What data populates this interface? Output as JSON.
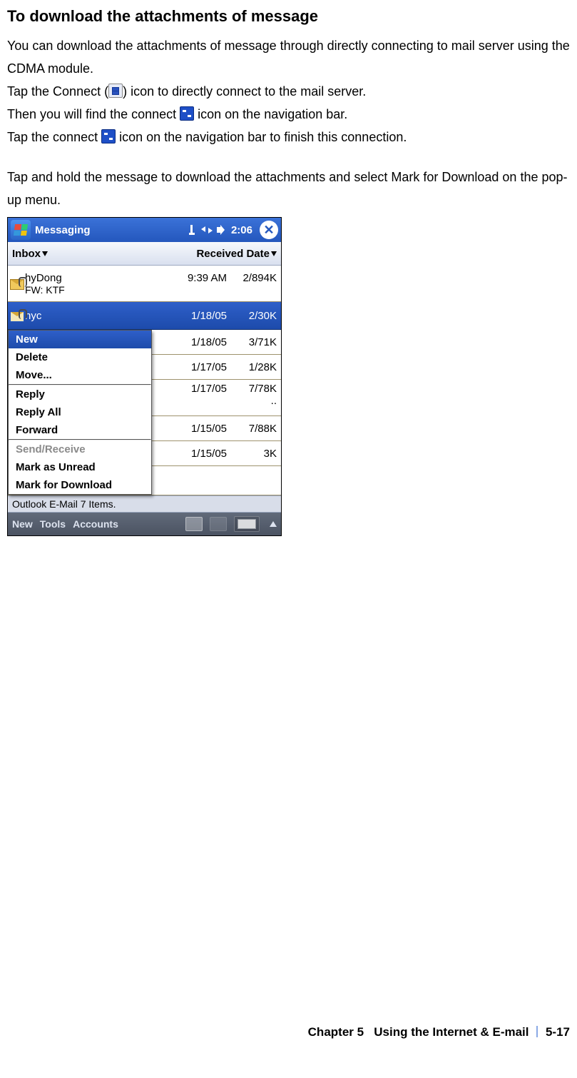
{
  "doc": {
    "heading": "To download the attachments of message",
    "p1a": "You can download the attachments of message through directly connecting to mail server using the CDMA module.",
    "p2a": "Tap the Connect (",
    "p2b": ") icon to directly connect to the mail server.",
    "p3a": "Then you will find the connect ",
    "p3b": " icon on the navigation bar.",
    "p4a": "Tap the connect ",
    "p4b": " icon on the navigation bar to finish this connection.",
    "p5": "Tap and hold the message to download the attachments and select Mark for Download on the pop-up menu."
  },
  "screenshot": {
    "titlebar": {
      "app": "Messaging",
      "time": "2:06"
    },
    "toolbar": {
      "folder": "Inbox",
      "sort": "Received Date"
    },
    "rows": {
      "r0": {
        "from": "hyDong",
        "subject": "FW: KTF",
        "date": "9:39 AM",
        "size": "2/894K"
      },
      "r1": {
        "from": "hyc",
        "date": "1/18/05",
        "size": "2/30K"
      },
      "r2": {
        "date": "1/18/05",
        "size": "3/71K"
      },
      "r3": {
        "date": "1/17/05",
        "size": "1/28K"
      },
      "r4": {
        "date": "1/17/05",
        "size": "7/78K",
        "extra": ".."
      },
      "r5": {
        "date": "1/15/05",
        "size": "7/88K"
      },
      "r6": {
        "date": "1/15/05",
        "size": "3K"
      }
    },
    "context_menu": {
      "new": "New",
      "delete": "Delete",
      "move": "Move...",
      "reply": "Reply",
      "reply_all": "Reply All",
      "forward": "Forward",
      "send_receive": "Send/Receive",
      "mark_unread": "Mark as Unread",
      "mark_download": "Mark for Download"
    },
    "status": "Outlook E-Mail  7 Items.",
    "bottombar": {
      "m1": "New",
      "m2": "Tools",
      "m3": "Accounts"
    }
  },
  "footer": {
    "chapter": "Chapter 5",
    "title": "Using the Internet & E-mail",
    "page": "5-17"
  }
}
